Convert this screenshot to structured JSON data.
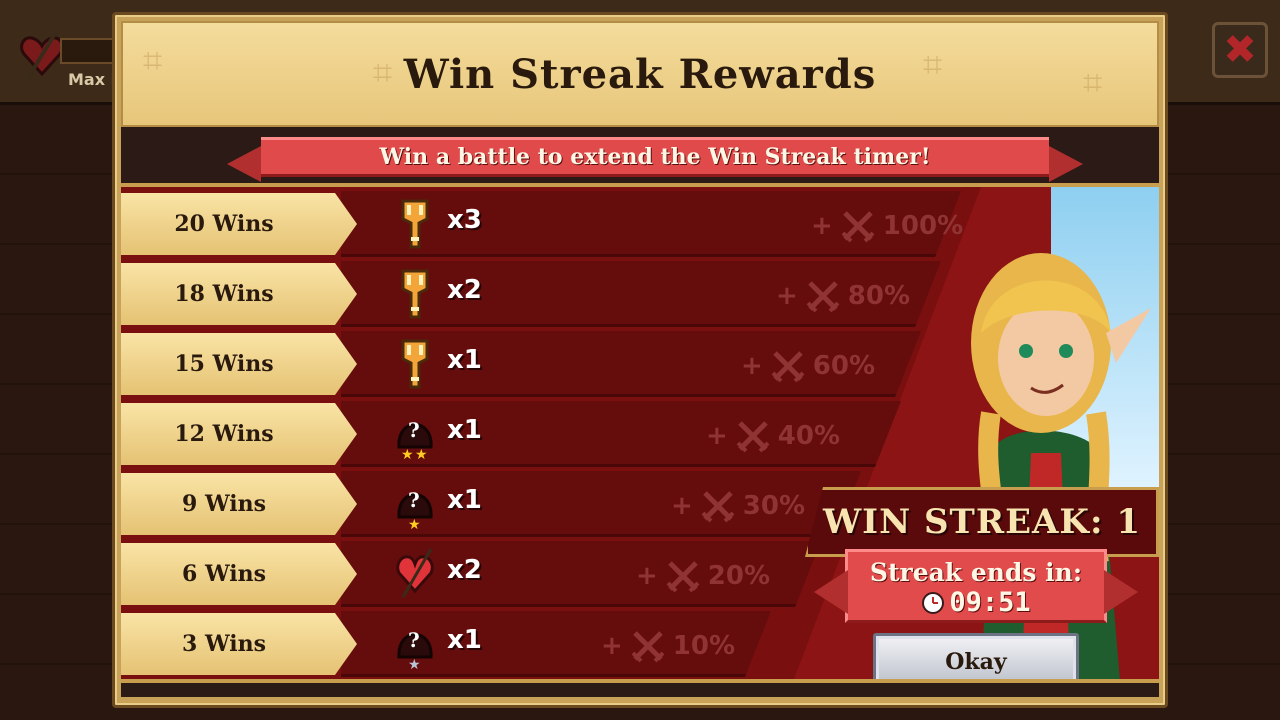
{
  "background": {
    "max_label": "Max i"
  },
  "modal": {
    "title": "Win Streak Rewards",
    "banner": "Win a battle to extend the Win Streak timer!",
    "rows": [
      {
        "wins": "20 Wins",
        "reward_icon": "gold-key-icon",
        "qty": "x3",
        "bonus": "100%"
      },
      {
        "wins": "18 Wins",
        "reward_icon": "gold-key-icon",
        "qty": "x2",
        "bonus": "80%"
      },
      {
        "wins": "15 Wins",
        "reward_icon": "gold-key-icon",
        "qty": "x1",
        "bonus": "60%"
      },
      {
        "wins": "12 Wins",
        "reward_icon": "mystery-hero-2-star-icon",
        "qty": "x1",
        "bonus": "40%"
      },
      {
        "wins": "9 Wins",
        "reward_icon": "mystery-hero-1-star-icon",
        "qty": "x1",
        "bonus": "30%"
      },
      {
        "wins": "6 Wins",
        "reward_icon": "red-heart-torch-icon",
        "qty": "x2",
        "bonus": "20%"
      },
      {
        "wins": "3 Wins",
        "reward_icon": "mystery-hero-silver-star-icon",
        "qty": "x1",
        "bonus": "10%"
      }
    ],
    "bonus_prefix": "+",
    "streak_label": "WIN STREAK: 1",
    "timer_title": "Streak ends in:",
    "timer_value": "09:51",
    "okay_label": "Okay"
  },
  "colors": {
    "row_red": "#650c0c",
    "tab_gold": "#f9e4a6",
    "banner_red": "#e04a4a",
    "bonus_text": "#8f3333"
  }
}
